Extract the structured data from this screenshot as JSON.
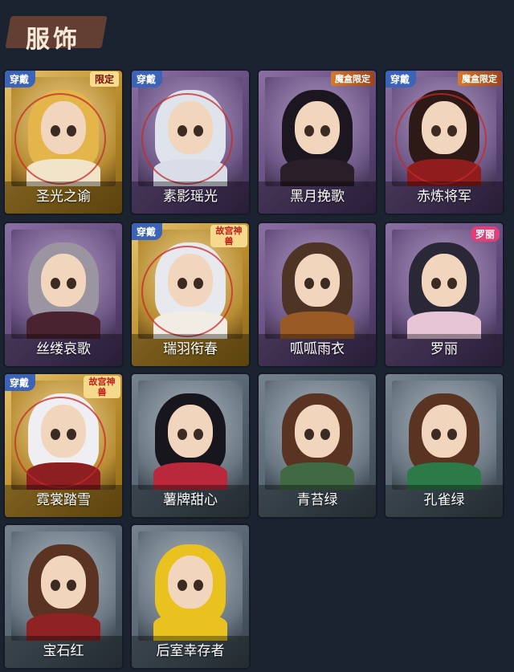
{
  "page_title": "服饰",
  "tags": {
    "worn": "穿戴",
    "limited": "限定",
    "box_limited": "魔盒限定",
    "palace_beast": "故宫神兽",
    "luoli": "罗丽"
  },
  "costumes": [
    {
      "name": "圣光之谕",
      "rarity": "gold",
      "worn": true,
      "corner": "limited",
      "hair": "#e3b54a",
      "body": "#f1e4c8"
    },
    {
      "name": "素影瑶光",
      "rarity": "purple",
      "worn": true,
      "corner": null,
      "hair": "#dfe3ec",
      "body": "#d8dde8"
    },
    {
      "name": "黑月挽歌",
      "rarity": "purple",
      "worn": false,
      "corner": "box_limited",
      "hair": "#1c1620",
      "body": "#2a1f29"
    },
    {
      "name": "赤炼将军",
      "rarity": "purple",
      "worn": true,
      "corner": "box_limited",
      "hair": "#2d1a16",
      "body": "#8f1d1d"
    },
    {
      "name": "丝缕哀歌",
      "rarity": "purple",
      "worn": false,
      "corner": null,
      "hair": "#9b95a2",
      "body": "#4a2330"
    },
    {
      "name": "瑞羽衔春",
      "rarity": "gold",
      "worn": true,
      "corner": "palace_beast",
      "hair": "#e8e9ef",
      "body": "#f2ede4"
    },
    {
      "name": "呱呱雨衣",
      "rarity": "purple",
      "worn": false,
      "corner": null,
      "hair": "#4e3424",
      "body": "#9a5a26"
    },
    {
      "name": "罗丽",
      "rarity": "purple",
      "worn": false,
      "corner": "luoli",
      "hair": "#2a2736",
      "body": "#e7c5d6"
    },
    {
      "name": "霓裳踏雪",
      "rarity": "gold",
      "worn": true,
      "corner": "palace_beast",
      "hair": "#efeff3",
      "body": "#8e1f20"
    },
    {
      "name": "薯牌甜心",
      "rarity": "grey",
      "worn": false,
      "corner": null,
      "hair": "#17161d",
      "body": "#b9283b"
    },
    {
      "name": "青苔绿",
      "rarity": "grey",
      "worn": false,
      "corner": null,
      "hair": "#5a3322",
      "body": "#3f6a42"
    },
    {
      "name": "孔雀绿",
      "rarity": "grey",
      "worn": false,
      "corner": null,
      "hair": "#5a3322",
      "body": "#2b7a48"
    },
    {
      "name": "宝石红",
      "rarity": "grey",
      "worn": false,
      "corner": null,
      "hair": "#5a3322",
      "body": "#8f2323"
    },
    {
      "name": "后室幸存者",
      "rarity": "grey",
      "worn": false,
      "corner": null,
      "hair": "#e9c21f",
      "body": "#e9c21f"
    }
  ]
}
